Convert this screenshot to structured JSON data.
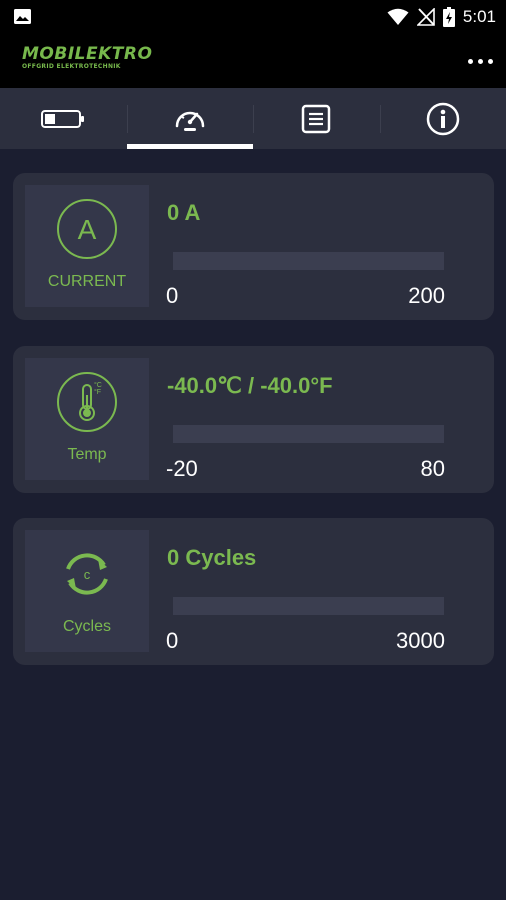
{
  "status_bar": {
    "time": "5:01",
    "icons": [
      "image-icon",
      "wifi-icon",
      "no-signal-icon",
      "battery-charging-icon"
    ]
  },
  "app_bar": {
    "logo_title": "MOBILEKTRO",
    "logo_subtitle": "OFFGRID ELEKTROTECHNIK",
    "menu_icon": "more-horizontal-icon"
  },
  "tabs": [
    {
      "icon": "battery-icon",
      "active": false
    },
    {
      "icon": "speedometer-icon",
      "active": true
    },
    {
      "icon": "list-icon",
      "active": false
    },
    {
      "icon": "info-icon",
      "active": false
    }
  ],
  "cards": [
    {
      "label": "CURRENT",
      "icon": "current-ampere-icon",
      "value": "0 A",
      "min": "0",
      "max": "200",
      "fill": 0
    },
    {
      "label": "Temp",
      "icon": "thermometer-icon",
      "value": "-40.0℃ / -40.0°F",
      "min": "-20",
      "max": "80",
      "fill": 0
    },
    {
      "label": "Cycles",
      "icon": "cycles-icon",
      "value": "0 Cycles",
      "min": "0",
      "max": "3000",
      "fill": 0
    }
  ],
  "colors": {
    "background": "#1b1e30",
    "card": "#2c2f3e",
    "accent_green": "#7bb950",
    "bar_track": "#3b3e50"
  }
}
